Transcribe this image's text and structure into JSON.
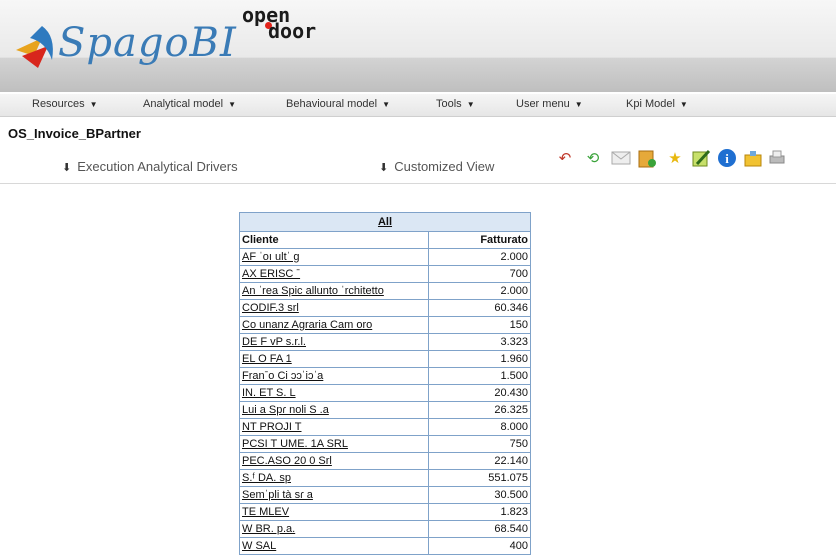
{
  "logo": {
    "left_brand": "SpagoBI",
    "right_brand_line1": "open",
    "right_brand_line2": "door"
  },
  "menu": [
    {
      "label": "Resources"
    },
    {
      "label": "Analytical model"
    },
    {
      "label": "Behavioural model"
    },
    {
      "label": "Tools"
    },
    {
      "label": "User menu"
    },
    {
      "label": "Kpi Model"
    }
  ],
  "document": {
    "title": "OS_Invoice_BPartner"
  },
  "drivers": {
    "execution_label": "Execution Analytical Drivers",
    "customized_label": "Customized View"
  },
  "toolbar_icons": [
    "back-icon",
    "refresh-icon",
    "email-icon",
    "export-icon",
    "favorite-star-icon",
    "note-icon",
    "info-icon",
    "snapshot-icon",
    "print-icon"
  ],
  "pivot": {
    "all_label": "All",
    "col_cliente": "Cliente",
    "col_fatturato": "Fatturato",
    "rows": [
      {
        "cliente": "AF ˈoı ultˈ g",
        "fatturato": "2.000"
      },
      {
        "cliente": "AX ERISC ˉ",
        "fatturato": "700"
      },
      {
        "cliente": "An ˈrea Spic allunto ˈrchitetto",
        "fatturato": "2.000"
      },
      {
        "cliente": "CODIF.3 srl",
        "fatturato": "60.346"
      },
      {
        "cliente": "Co unanz Agraria Cam oro",
        "fatturato": "150"
      },
      {
        "cliente": "DE F vP s.r.l.",
        "fatturato": "3.323"
      },
      {
        "cliente": "EL O FA 1",
        "fatturato": "1.960"
      },
      {
        "cliente": "Franˉo Ci ɔɔˈiɔˈa",
        "fatturato": "1.500"
      },
      {
        "cliente": "IN. ET S. L",
        "fatturato": "20.430"
      },
      {
        "cliente": "Lui a Spɾ noli S .a",
        "fatturato": "26.325"
      },
      {
        "cliente": "NT PROJI T",
        "fatturato": "8.000"
      },
      {
        "cliente": "PCSI T UME. 1A SRL",
        "fatturato": "750"
      },
      {
        "cliente": "PEC.ASO 20 0 Srl",
        "fatturato": "22.140"
      },
      {
        "cliente": "S.ᶠ DA. sp",
        "fatturato": "551.075"
      },
      {
        "cliente": "Semˈpli tà sɾ a",
        "fatturato": "30.500"
      },
      {
        "cliente": "TE MLEV",
        "fatturato": "1.823"
      },
      {
        "cliente": "W BR. p.a.",
        "fatturato": "68.540"
      },
      {
        "cliente": "W SAL",
        "fatturato": "400"
      }
    ]
  }
}
